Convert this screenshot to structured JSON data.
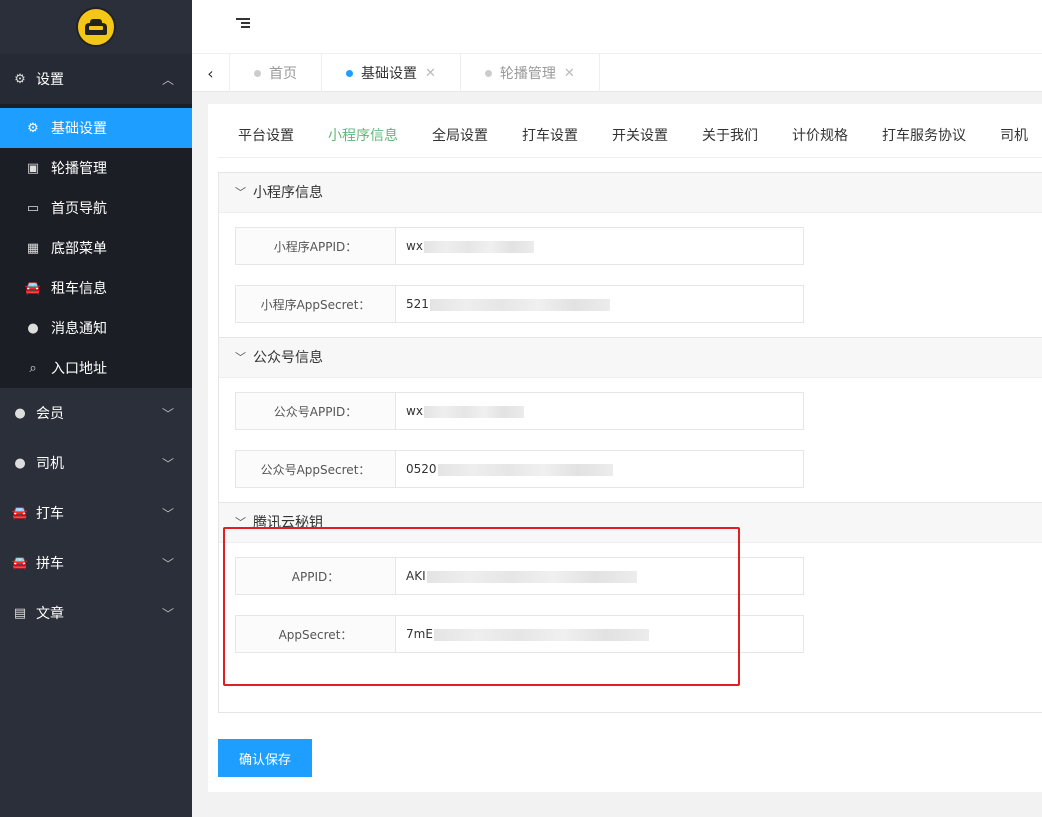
{
  "sidebar": {
    "settings": {
      "label": "设置",
      "icon": "gear-icon"
    },
    "sub_items": [
      {
        "label": "基础设置",
        "icon": "gear-icon",
        "active": true
      },
      {
        "label": "轮播管理",
        "icon": "image-icon"
      },
      {
        "label": "首页导航",
        "icon": "monitor-icon"
      },
      {
        "label": "底部菜单",
        "icon": "grid-icon"
      },
      {
        "label": "租车信息",
        "icon": "car-icon"
      },
      {
        "label": "消息通知",
        "icon": "chat-icon"
      },
      {
        "label": "入口地址",
        "icon": "search-icon"
      }
    ],
    "groups": [
      {
        "label": "会员",
        "icon": "user-icon"
      },
      {
        "label": "司机",
        "icon": "users-icon"
      },
      {
        "label": "打车",
        "icon": "car-icon"
      },
      {
        "label": "拼车",
        "icon": "car-icon"
      },
      {
        "label": "文章",
        "icon": "newspaper-icon"
      }
    ]
  },
  "page_tabs": [
    {
      "label": "首页",
      "active": false,
      "closable": false
    },
    {
      "label": "基础设置",
      "active": true,
      "closable": true
    },
    {
      "label": "轮播管理",
      "active": false,
      "closable": true
    }
  ],
  "settings_tabs": [
    "平台设置",
    "小程序信息",
    "全局设置",
    "打车设置",
    "开关设置",
    "关于我们",
    "计价规格",
    "打车服务协议",
    "司机"
  ],
  "sections": [
    {
      "title": "小程序信息",
      "fields": [
        {
          "label": "小程序APPID：",
          "value_prefix": "wx"
        },
        {
          "label": "小程序AppSecret：",
          "value_prefix": "521"
        }
      ]
    },
    {
      "title": "公众号信息",
      "fields": [
        {
          "label": "公众号APPID：",
          "value_prefix": "wx"
        },
        {
          "label": "公众号AppSecret：",
          "value_prefix": "0520"
        }
      ]
    },
    {
      "title": "腾讯云秘钥",
      "fields": [
        {
          "label": "APPID：",
          "value_prefix": "AKI"
        },
        {
          "label": "AppSecret：",
          "value_prefix": "7mE"
        }
      ]
    }
  ],
  "save_button": "确认保存",
  "colors": {
    "sidebar_bg": "#2a2f3a",
    "active_blue": "#1e9fff",
    "tab_green": "#5fb878",
    "highlight_red": "#e02020"
  }
}
